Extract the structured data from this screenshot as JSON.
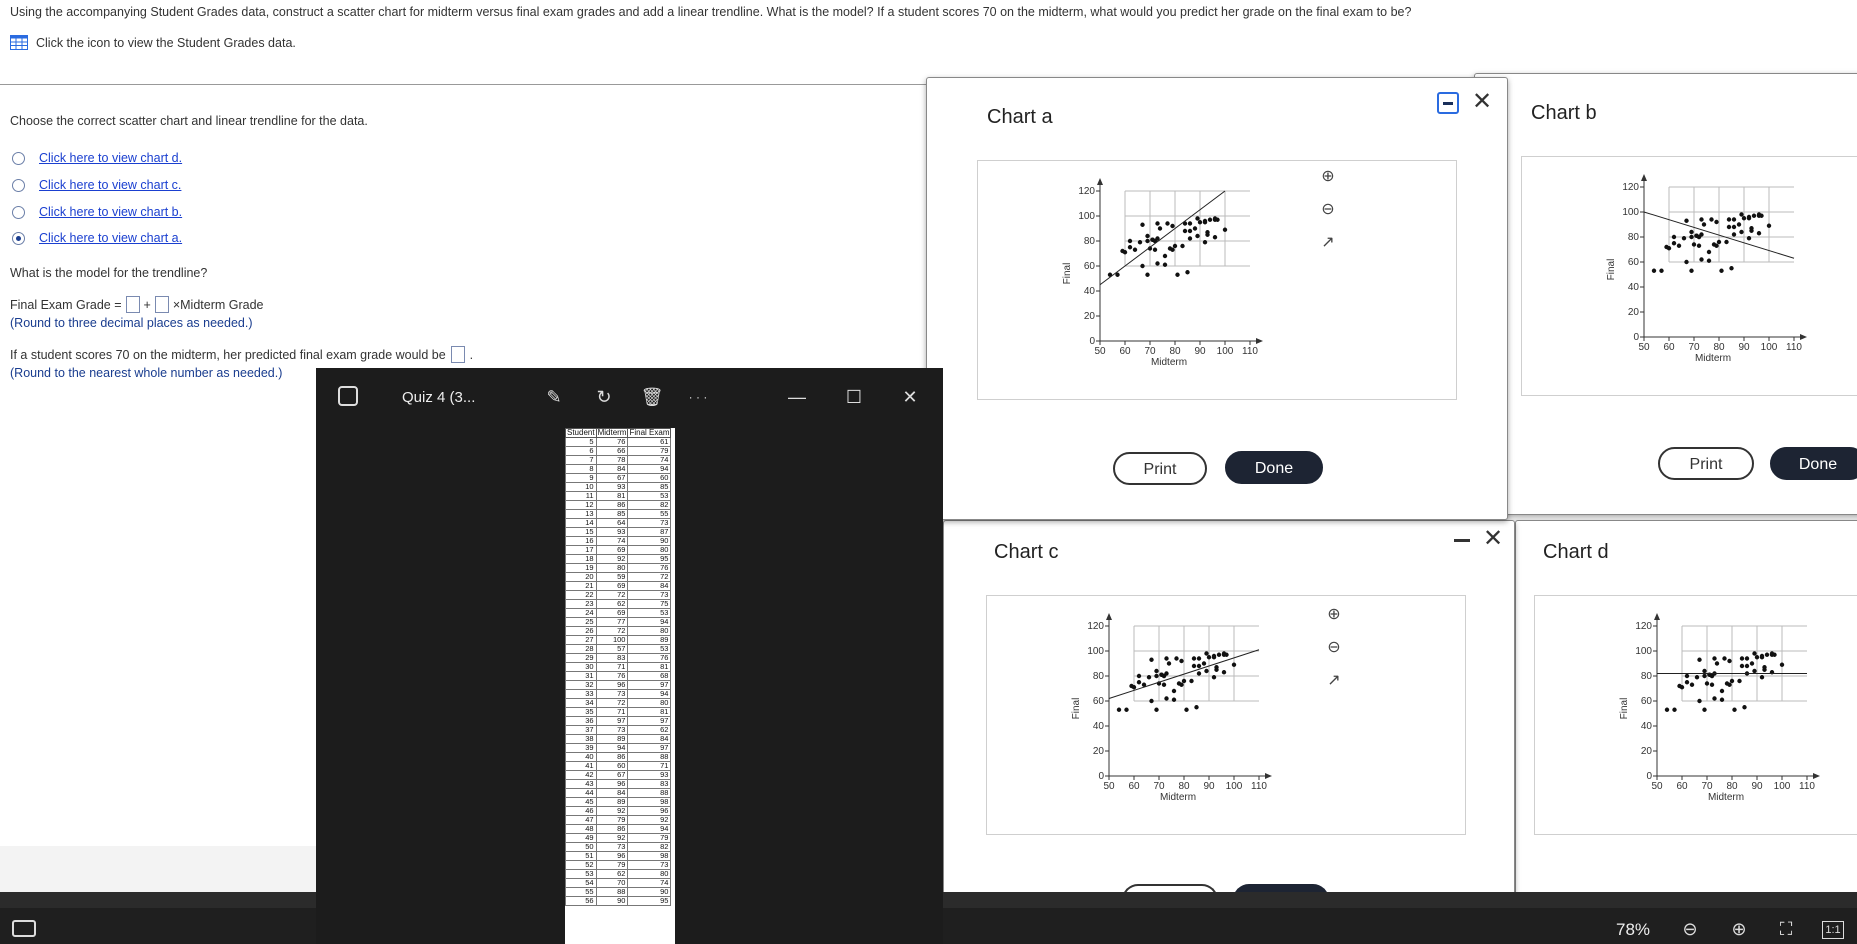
{
  "question": {
    "text": "Using the accompanying Student Grades data, construct a scatter chart for midterm versus final exam grades and add a linear trendline. What is the model? If a student scores 70 on the midterm, what would you predict her grade on the final exam to be?",
    "data_link": "Click the icon to view the Student Grades data.",
    "choose_prompt": "Choose the correct scatter chart and linear trendline for the data.",
    "options": [
      {
        "label": "Click here to view chart d.",
        "selected": false
      },
      {
        "label": "Click here to view chart c.",
        "selected": false
      },
      {
        "label": "Click here to view chart b.",
        "selected": false
      },
      {
        "label": "Click here to view chart a.",
        "selected": true
      }
    ],
    "model_prompt": "What is the model for the trendline?",
    "eq_prefix": "Final Exam Grade =",
    "eq_plus": "+",
    "eq_suffix": "×Midterm Grade",
    "round1": "(Round to three decimal places as needed.)",
    "pred_prefix": "If a student scores 70 on the midterm, her predicted final exam grade would be",
    "pred_suffix": ".",
    "round2": "(Round to the nearest whole number as needed.)"
  },
  "viewer": {
    "title": "Quiz 4 (3...",
    "more": "· · ·",
    "sheet_headers": [
      "Student",
      "Midterm",
      "Final Exam"
    ],
    "rows": [
      [
        "5",
        "76",
        "61"
      ],
      [
        "6",
        "66",
        "79"
      ],
      [
        "7",
        "78",
        "74"
      ],
      [
        "8",
        "84",
        "94"
      ],
      [
        "9",
        "67",
        "60"
      ],
      [
        "10",
        "93",
        "85"
      ],
      [
        "11",
        "81",
        "53"
      ],
      [
        "12",
        "86",
        "82"
      ],
      [
        "13",
        "85",
        "55"
      ],
      [
        "14",
        "64",
        "73"
      ],
      [
        "15",
        "93",
        "87"
      ],
      [
        "16",
        "74",
        "90"
      ],
      [
        "17",
        "69",
        "80"
      ],
      [
        "18",
        "92",
        "95"
      ],
      [
        "19",
        "80",
        "76"
      ],
      [
        "20",
        "59",
        "72"
      ],
      [
        "21",
        "69",
        "84"
      ],
      [
        "22",
        "72",
        "73"
      ],
      [
        "23",
        "62",
        "75"
      ],
      [
        "24",
        "69",
        "53"
      ],
      [
        "25",
        "77",
        "94"
      ],
      [
        "26",
        "72",
        "80"
      ],
      [
        "27",
        "100",
        "89"
      ],
      [
        "28",
        "57",
        "53"
      ],
      [
        "29",
        "83",
        "76"
      ],
      [
        "30",
        "71",
        "81"
      ],
      [
        "31",
        "76",
        "68"
      ],
      [
        "32",
        "96",
        "97"
      ],
      [
        "33",
        "73",
        "94"
      ],
      [
        "34",
        "72",
        "80"
      ],
      [
        "35",
        "71",
        "81"
      ],
      [
        "36",
        "97",
        "97"
      ],
      [
        "37",
        "73",
        "62"
      ],
      [
        "38",
        "89",
        "84"
      ],
      [
        "39",
        "94",
        "97"
      ],
      [
        "40",
        "86",
        "88"
      ],
      [
        "41",
        "60",
        "71"
      ],
      [
        "42",
        "67",
        "93"
      ],
      [
        "43",
        "96",
        "83"
      ],
      [
        "44",
        "84",
        "88"
      ],
      [
        "45",
        "89",
        "98"
      ],
      [
        "46",
        "92",
        "96"
      ],
      [
        "47",
        "79",
        "92"
      ],
      [
        "48",
        "86",
        "94"
      ],
      [
        "49",
        "92",
        "79"
      ],
      [
        "50",
        "73",
        "82"
      ],
      [
        "51",
        "96",
        "98"
      ],
      [
        "52",
        "79",
        "73"
      ],
      [
        "53",
        "62",
        "80"
      ],
      [
        "54",
        "70",
        "74"
      ],
      [
        "55",
        "88",
        "90"
      ],
      [
        "56",
        "90",
        "95"
      ]
    ]
  },
  "dialogs": {
    "a": {
      "title": "Chart a",
      "print": "Print",
      "done": "Done"
    },
    "b": {
      "title": "Chart b",
      "print": "Print",
      "done": "Done"
    },
    "c": {
      "title": "Chart c"
    },
    "d": {
      "title": "Chart d"
    }
  },
  "bottom": {
    "zoom": "78%",
    "one_to_one": "1:1"
  },
  "chart_data": [
    {
      "type": "scatter",
      "title": "Chart a",
      "xlabel": "Midterm",
      "ylabel": "Final",
      "xlim": [
        50,
        110
      ],
      "ylim": [
        0,
        120
      ],
      "xticks": [
        50,
        60,
        70,
        80,
        90,
        100,
        110
      ],
      "yticks": [
        0,
        20,
        40,
        60,
        80,
        100,
        120
      ],
      "trendline": {
        "x": [
          50,
          100
        ],
        "y": [
          45,
          120
        ]
      },
      "points": [
        [
          54,
          53
        ],
        [
          57,
          53
        ],
        [
          59,
          72
        ],
        [
          60,
          71
        ],
        [
          62,
          75
        ],
        [
          62,
          80
        ],
        [
          64,
          73
        ],
        [
          66,
          79
        ],
        [
          67,
          60
        ],
        [
          67,
          93
        ],
        [
          69,
          53
        ],
        [
          69,
          80
        ],
        [
          69,
          84
        ],
        [
          70,
          74
        ],
        [
          71,
          81
        ],
        [
          71,
          81
        ],
        [
          72,
          73
        ],
        [
          72,
          80
        ],
        [
          72,
          80
        ],
        [
          73,
          62
        ],
        [
          73,
          82
        ],
        [
          73,
          94
        ],
        [
          74,
          90
        ],
        [
          76,
          61
        ],
        [
          76,
          68
        ],
        [
          77,
          94
        ],
        [
          78,
          74
        ],
        [
          79,
          73
        ],
        [
          79,
          92
        ],
        [
          80,
          76
        ],
        [
          81,
          53
        ],
        [
          83,
          76
        ],
        [
          84,
          88
        ],
        [
          84,
          94
        ],
        [
          85,
          55
        ],
        [
          86,
          82
        ],
        [
          86,
          88
        ],
        [
          86,
          94
        ],
        [
          88,
          90
        ],
        [
          89,
          84
        ],
        [
          89,
          98
        ],
        [
          90,
          95
        ],
        [
          92,
          79
        ],
        [
          92,
          95
        ],
        [
          92,
          96
        ],
        [
          93,
          85
        ],
        [
          93,
          87
        ],
        [
          94,
          97
        ],
        [
          96,
          83
        ],
        [
          96,
          97
        ],
        [
          96,
          98
        ],
        [
          97,
          97
        ],
        [
          100,
          89
        ]
      ]
    },
    {
      "type": "scatter",
      "title": "Chart b",
      "xlabel": "Midterm",
      "ylabel": "Final",
      "xlim": [
        50,
        110
      ],
      "ylim": [
        0,
        120
      ],
      "xticks": [
        50,
        60,
        70,
        80,
        90,
        100,
        110
      ],
      "yticks": [
        0,
        20,
        40,
        60,
        80,
        100,
        120
      ],
      "trendline": {
        "x": [
          50,
          110
        ],
        "y": [
          100,
          63
        ]
      },
      "points": [
        [
          54,
          53
        ],
        [
          57,
          53
        ],
        [
          59,
          72
        ],
        [
          60,
          71
        ],
        [
          62,
          75
        ],
        [
          62,
          80
        ],
        [
          64,
          73
        ],
        [
          66,
          79
        ],
        [
          67,
          60
        ],
        [
          67,
          93
        ],
        [
          69,
          53
        ],
        [
          69,
          80
        ],
        [
          69,
          84
        ],
        [
          70,
          74
        ],
        [
          71,
          81
        ],
        [
          71,
          81
        ],
        [
          72,
          73
        ],
        [
          72,
          80
        ],
        [
          72,
          80
        ],
        [
          73,
          62
        ],
        [
          73,
          82
        ],
        [
          73,
          94
        ],
        [
          74,
          90
        ],
        [
          76,
          61
        ],
        [
          76,
          68
        ],
        [
          77,
          94
        ],
        [
          78,
          74
        ],
        [
          79,
          73
        ],
        [
          79,
          92
        ],
        [
          80,
          76
        ],
        [
          81,
          53
        ],
        [
          83,
          76
        ],
        [
          84,
          88
        ],
        [
          84,
          94
        ],
        [
          85,
          55
        ],
        [
          86,
          82
        ],
        [
          86,
          88
        ],
        [
          86,
          94
        ],
        [
          88,
          90
        ],
        [
          89,
          84
        ],
        [
          89,
          98
        ],
        [
          90,
          95
        ],
        [
          92,
          79
        ],
        [
          92,
          95
        ],
        [
          92,
          96
        ],
        [
          93,
          85
        ],
        [
          93,
          87
        ],
        [
          94,
          97
        ],
        [
          96,
          83
        ],
        [
          96,
          97
        ],
        [
          96,
          98
        ],
        [
          97,
          97
        ],
        [
          100,
          89
        ]
      ]
    },
    {
      "type": "scatter",
      "title": "Chart c",
      "xlabel": "Midterm",
      "ylabel": "Final",
      "xlim": [
        50,
        110
      ],
      "ylim": [
        0,
        120
      ],
      "xticks": [
        50,
        60,
        70,
        80,
        90,
        100,
        110
      ],
      "yticks": [
        0,
        20,
        40,
        60,
        80,
        100,
        120
      ],
      "trendline": {
        "x": [
          50,
          110
        ],
        "y": [
          62,
          101
        ]
      },
      "points": [
        [
          54,
          53
        ],
        [
          57,
          53
        ],
        [
          59,
          72
        ],
        [
          60,
          71
        ],
        [
          62,
          75
        ],
        [
          62,
          80
        ],
        [
          64,
          73
        ],
        [
          66,
          79
        ],
        [
          67,
          60
        ],
        [
          67,
          93
        ],
        [
          69,
          53
        ],
        [
          69,
          80
        ],
        [
          69,
          84
        ],
        [
          70,
          74
        ],
        [
          71,
          81
        ],
        [
          71,
          81
        ],
        [
          72,
          73
        ],
        [
          72,
          80
        ],
        [
          72,
          80
        ],
        [
          73,
          62
        ],
        [
          73,
          82
        ],
        [
          73,
          94
        ],
        [
          74,
          90
        ],
        [
          76,
          61
        ],
        [
          76,
          68
        ],
        [
          77,
          94
        ],
        [
          78,
          74
        ],
        [
          79,
          73
        ],
        [
          79,
          92
        ],
        [
          80,
          76
        ],
        [
          81,
          53
        ],
        [
          83,
          76
        ],
        [
          84,
          88
        ],
        [
          84,
          94
        ],
        [
          85,
          55
        ],
        [
          86,
          82
        ],
        [
          86,
          88
        ],
        [
          86,
          94
        ],
        [
          88,
          90
        ],
        [
          89,
          84
        ],
        [
          89,
          98
        ],
        [
          90,
          95
        ],
        [
          92,
          79
        ],
        [
          92,
          95
        ],
        [
          92,
          96
        ],
        [
          93,
          85
        ],
        [
          93,
          87
        ],
        [
          94,
          97
        ],
        [
          96,
          83
        ],
        [
          96,
          97
        ],
        [
          96,
          98
        ],
        [
          97,
          97
        ],
        [
          100,
          89
        ]
      ]
    },
    {
      "type": "scatter",
      "title": "Chart d",
      "xlabel": "Midterm",
      "ylabel": "Final",
      "xlim": [
        50,
        110
      ],
      "ylim": [
        0,
        120
      ],
      "xticks": [
        50,
        60,
        70,
        80,
        90,
        100,
        110
      ],
      "yticks": [
        0,
        20,
        40,
        60,
        80,
        100,
        120
      ],
      "trendline": {
        "x": [
          50,
          110
        ],
        "y": [
          82,
          82
        ]
      },
      "points": [
        [
          54,
          53
        ],
        [
          57,
          53
        ],
        [
          59,
          72
        ],
        [
          60,
          71
        ],
        [
          62,
          75
        ],
        [
          62,
          80
        ],
        [
          64,
          73
        ],
        [
          66,
          79
        ],
        [
          67,
          60
        ],
        [
          67,
          93
        ],
        [
          69,
          53
        ],
        [
          69,
          80
        ],
        [
          69,
          84
        ],
        [
          70,
          74
        ],
        [
          71,
          81
        ],
        [
          71,
          81
        ],
        [
          72,
          73
        ],
        [
          72,
          80
        ],
        [
          72,
          80
        ],
        [
          73,
          62
        ],
        [
          73,
          82
        ],
        [
          73,
          94
        ],
        [
          74,
          90
        ],
        [
          76,
          61
        ],
        [
          76,
          68
        ],
        [
          77,
          94
        ],
        [
          78,
          74
        ],
        [
          79,
          73
        ],
        [
          79,
          92
        ],
        [
          80,
          76
        ],
        [
          81,
          53
        ],
        [
          83,
          76
        ],
        [
          84,
          88
        ],
        [
          84,
          94
        ],
        [
          85,
          55
        ],
        [
          86,
          82
        ],
        [
          86,
          88
        ],
        [
          86,
          94
        ],
        [
          88,
          90
        ],
        [
          89,
          84
        ],
        [
          89,
          98
        ],
        [
          90,
          95
        ],
        [
          92,
          79
        ],
        [
          92,
          95
        ],
        [
          92,
          96
        ],
        [
          93,
          85
        ],
        [
          93,
          87
        ],
        [
          94,
          97
        ],
        [
          96,
          83
        ],
        [
          96,
          97
        ],
        [
          96,
          98
        ],
        [
          97,
          97
        ],
        [
          100,
          89
        ]
      ]
    }
  ]
}
